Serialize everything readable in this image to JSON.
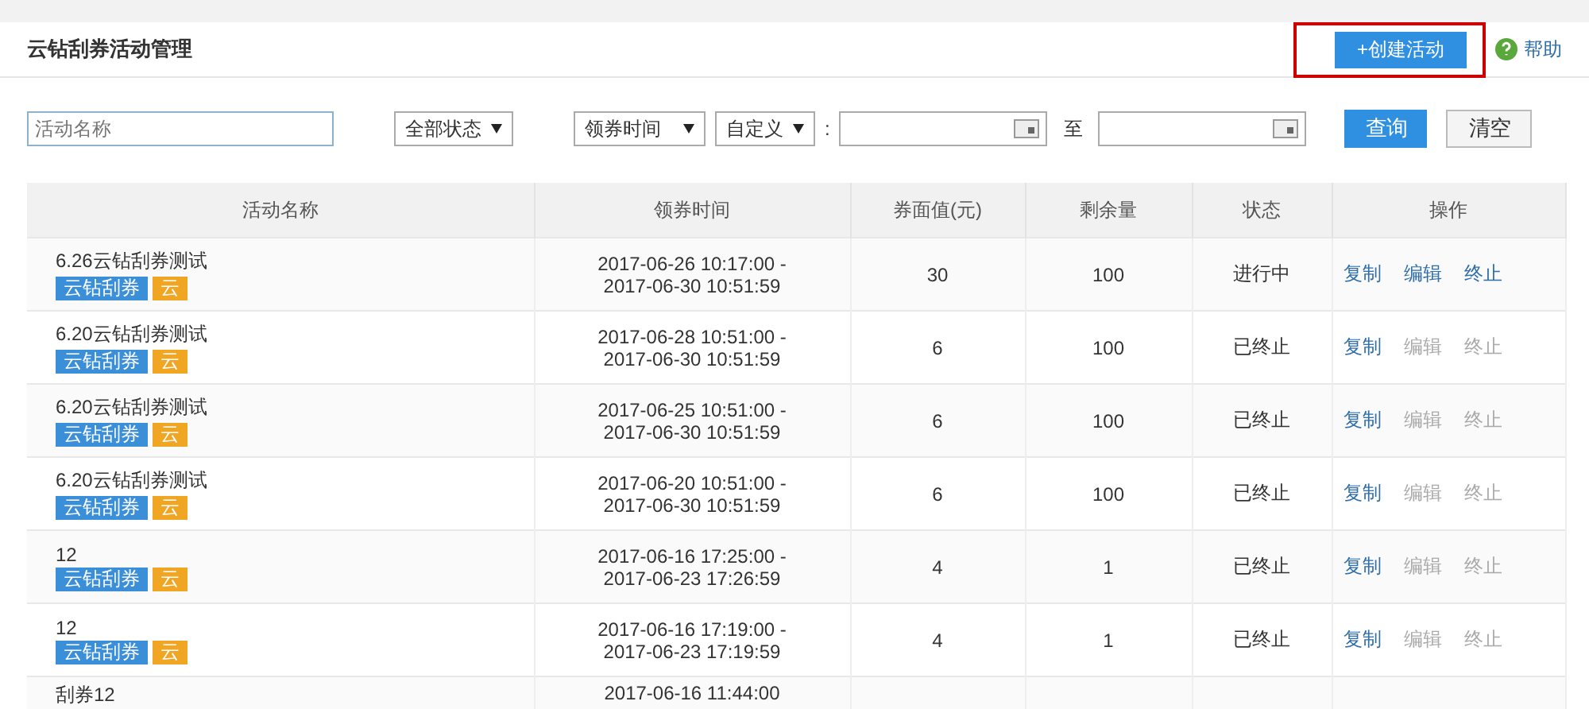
{
  "header": {
    "title": "云钻刮券活动管理",
    "create_button": {
      "label": "+创建活动",
      "highlighted": true
    },
    "help": {
      "label": "帮助"
    }
  },
  "filters": {
    "name_field": {
      "placeholder": "活动名称"
    },
    "status_select": "全部状态",
    "time_type_select": "领券时间",
    "range_select": "自定义",
    "colon": ":",
    "to_label": "至",
    "query_button": "查询",
    "clear_button": "清空"
  },
  "table": {
    "columns": [
      "活动名称",
      "领券时间",
      "券面值(元)",
      "剩余量",
      "状态",
      "操作"
    ],
    "rows": [
      {
        "name": "6.26云钻刮券测试",
        "tags": [
          {
            "label": "云钻刮券",
            "color": "#3b8fd9"
          },
          {
            "label": "云",
            "color": "#f0a623"
          }
        ],
        "time_start": "2017-06-26 10:17:00 -",
        "time_end": "2017-06-30 10:51:59",
        "value": "30",
        "remaining": "100",
        "status": "进行中",
        "actions": [
          {
            "label": "复制",
            "disabled": false
          },
          {
            "label": "编辑",
            "disabled": false
          },
          {
            "label": "终止",
            "disabled": false
          }
        ]
      },
      {
        "name": "6.20云钻刮券测试",
        "tags": [
          {
            "label": "云钻刮券",
            "color": "#3b8fd9"
          },
          {
            "label": "云",
            "color": "#f0a623"
          }
        ],
        "time_start": "2017-06-28 10:51:00 -",
        "time_end": "2017-06-30 10:51:59",
        "value": "6",
        "remaining": "100",
        "status": "已终止",
        "actions": [
          {
            "label": "复制",
            "disabled": false
          },
          {
            "label": "编辑",
            "disabled": true
          },
          {
            "label": "终止",
            "disabled": true
          }
        ]
      },
      {
        "name": "6.20云钻刮券测试",
        "tags": [
          {
            "label": "云钻刮券",
            "color": "#3b8fd9"
          },
          {
            "label": "云",
            "color": "#f0a623"
          }
        ],
        "time_start": "2017-06-25 10:51:00 -",
        "time_end": "2017-06-30 10:51:59",
        "value": "6",
        "remaining": "100",
        "status": "已终止",
        "actions": [
          {
            "label": "复制",
            "disabled": false
          },
          {
            "label": "编辑",
            "disabled": true
          },
          {
            "label": "终止",
            "disabled": true
          }
        ]
      },
      {
        "name": "6.20云钻刮券测试",
        "tags": [
          {
            "label": "云钻刮券",
            "color": "#3b8fd9"
          },
          {
            "label": "云",
            "color": "#f0a623"
          }
        ],
        "time_start": "2017-06-20 10:51:00 -",
        "time_end": "2017-06-30 10:51:59",
        "value": "6",
        "remaining": "100",
        "status": "已终止",
        "actions": [
          {
            "label": "复制",
            "disabled": false
          },
          {
            "label": "编辑",
            "disabled": true
          },
          {
            "label": "终止",
            "disabled": true
          }
        ]
      },
      {
        "name": "12",
        "tags": [
          {
            "label": "云钻刮券",
            "color": "#3b8fd9"
          },
          {
            "label": "云",
            "color": "#f0a623"
          }
        ],
        "time_start": "2017-06-16 17:25:00 -",
        "time_end": "2017-06-23 17:26:59",
        "value": "4",
        "remaining": "1",
        "status": "已终止",
        "actions": [
          {
            "label": "复制",
            "disabled": false
          },
          {
            "label": "编辑",
            "disabled": true
          },
          {
            "label": "终止",
            "disabled": true
          }
        ]
      },
      {
        "name": "12",
        "tags": [
          {
            "label": "云钻刮券",
            "color": "#3b8fd9"
          },
          {
            "label": "云",
            "color": "#f0a623"
          }
        ],
        "time_start": "2017-06-16 17:19:00 -",
        "time_end": "2017-06-23 17:19:59",
        "value": "4",
        "remaining": "1",
        "status": "已终止",
        "actions": [
          {
            "label": "复制",
            "disabled": false
          },
          {
            "label": "编辑",
            "disabled": true
          },
          {
            "label": "终止",
            "disabled": true
          }
        ]
      },
      {
        "name": "刮券12",
        "time_start": "2017-06-16 11:44:00"
      }
    ]
  }
}
